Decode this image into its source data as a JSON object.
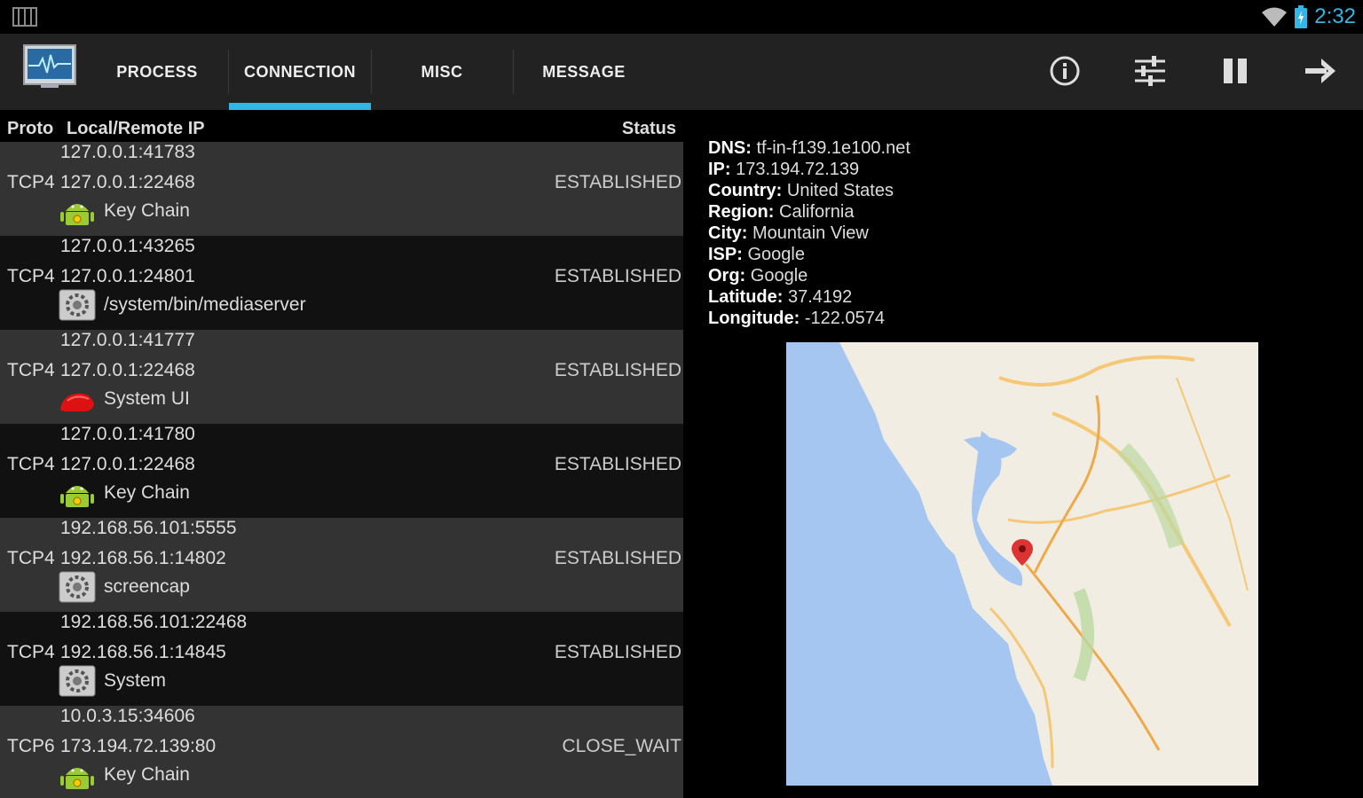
{
  "status_bar": {
    "time": "2:32"
  },
  "tabs": [
    {
      "label": "PROCESS",
      "active": false
    },
    {
      "label": "CONNECTION",
      "active": true
    },
    {
      "label": "MISC",
      "active": false
    },
    {
      "label": "MESSAGE",
      "active": false
    }
  ],
  "actions": [
    "info-icon",
    "settings-sliders-icon",
    "pause-icon",
    "forward-arrow-icon"
  ],
  "list_header": {
    "proto": "Proto",
    "ip": "Local/Remote IP",
    "status": "Status"
  },
  "connections": [
    {
      "local": "127.0.0.1:41783",
      "proto": "TCP4",
      "remote": "127.0.0.1:22468",
      "status": "ESTABLISHED",
      "app": "Key Chain",
      "icon": "android-icon"
    },
    {
      "local": "127.0.0.1:43265",
      "proto": "TCP4",
      "remote": "127.0.0.1:24801",
      "status": "ESTABLISHED",
      "app": "/system/bin/mediaserver",
      "icon": "system-gear-icon"
    },
    {
      "local": "127.0.0.1:41777",
      "proto": "TCP4",
      "remote": "127.0.0.1:22468",
      "status": "ESTABLISHED",
      "app": "System UI",
      "icon": "system-ui-icon"
    },
    {
      "local": "127.0.0.1:41780",
      "proto": "TCP4",
      "remote": "127.0.0.1:22468",
      "status": "ESTABLISHED",
      "app": "Key Chain",
      "icon": "android-icon"
    },
    {
      "local": "192.168.56.101:5555",
      "proto": "TCP4",
      "remote": "192.168.56.1:14802",
      "status": "ESTABLISHED",
      "app": "screencap",
      "icon": "system-gear-icon"
    },
    {
      "local": "192.168.56.101:22468",
      "proto": "TCP4",
      "remote": "192.168.56.1:14845",
      "status": "ESTABLISHED",
      "app": "System",
      "icon": "system-gear-icon"
    },
    {
      "local": "10.0.3.15:34606",
      "proto": "TCP6",
      "remote": "173.194.72.139:80",
      "status": "CLOSE_WAIT",
      "app": "Key Chain",
      "icon": "android-icon"
    }
  ],
  "detail": {
    "dns_label": "DNS:",
    "dns": "tf-in-f139.1e100.net",
    "ip_label": "IP:",
    "ip": "173.194.72.139",
    "country_label": "Country:",
    "country": "United States",
    "region_label": "Region:",
    "region": "California",
    "city_label": "City:",
    "city": "Mountain View",
    "isp_label": "ISP:",
    "isp": "Google",
    "org_label": "Org:",
    "org": "Google",
    "lat_label": "Latitude:",
    "lat": "37.4192",
    "lon_label": "Longitude:",
    "lon": "-122.0574"
  },
  "colors": {
    "accent": "#33b5e5",
    "row_alt": "#333333",
    "row_dark": "#111111"
  }
}
